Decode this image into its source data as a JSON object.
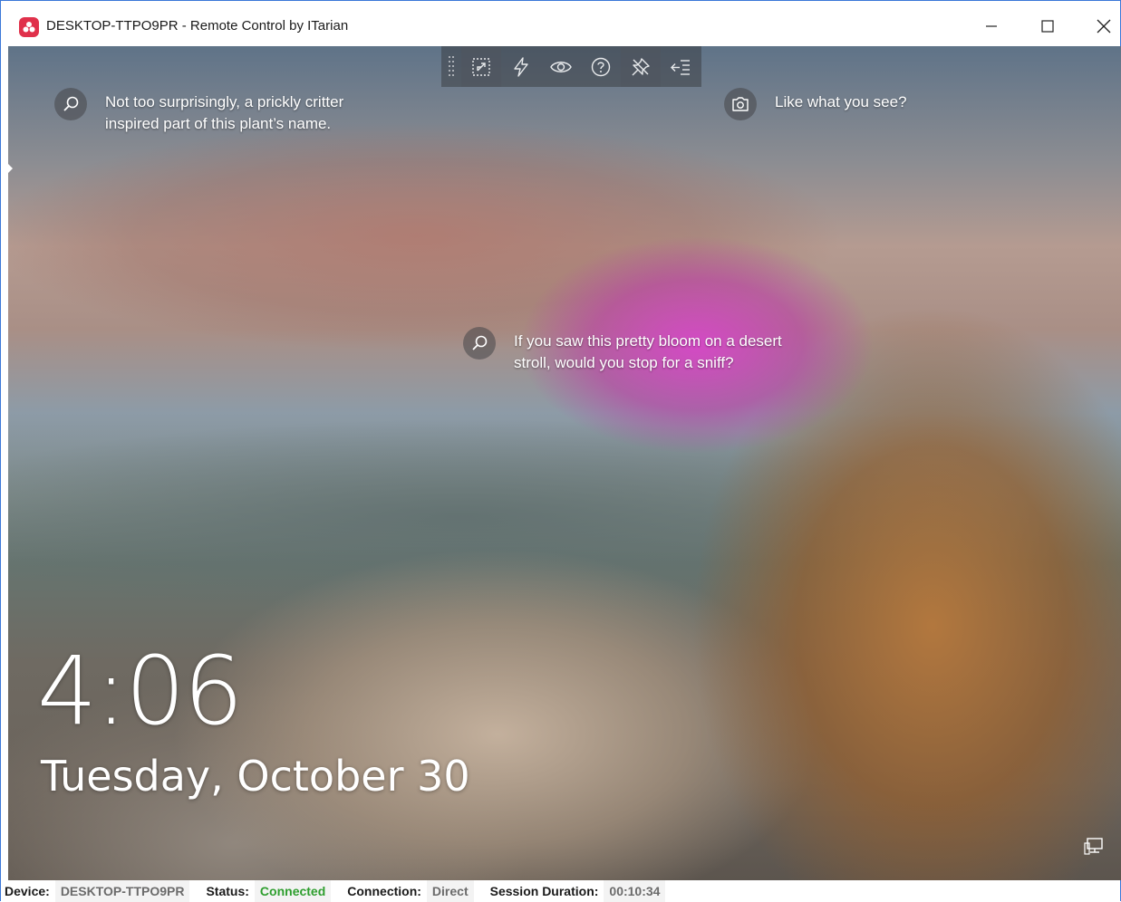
{
  "window": {
    "title": "DESKTOP-TTPO9PR - Remote Control by ITarian"
  },
  "toolbar": {
    "buttons": [
      {
        "icon": "fit-screen-icon",
        "active": true
      },
      {
        "icon": "lightning-icon",
        "active": false
      },
      {
        "icon": "eye-icon",
        "active": false
      },
      {
        "icon": "help-icon",
        "active": false
      },
      {
        "icon": "unpin-icon",
        "active": true
      },
      {
        "icon": "collapse-toolbar-icon",
        "active": false
      }
    ]
  },
  "lockscreen": {
    "hotspots": [
      {
        "icon": "search-icon",
        "text": "Not too surprisingly, a prickly critter inspired part of this plant’s name."
      },
      {
        "icon": "camera-icon",
        "text": "Like what you see?"
      },
      {
        "icon": "search-icon",
        "text": "If you saw this pretty bloom on a desert stroll, would you stop for a sniff?"
      }
    ],
    "time": "4:06",
    "date": "Tuesday, October 30"
  },
  "statusbar": {
    "device_label": "Device:",
    "device_value": "DESKTOP-TTPO9PR",
    "status_label": "Status:",
    "status_value": "Connected",
    "connection_label": "Connection:",
    "connection_value": "Direct",
    "duration_label": "Session Duration:",
    "duration_value": "00:10:34"
  },
  "colors": {
    "brand": "#e0314b",
    "status_ok": "#2e9e2e",
    "window_border": "#3b78d8"
  }
}
